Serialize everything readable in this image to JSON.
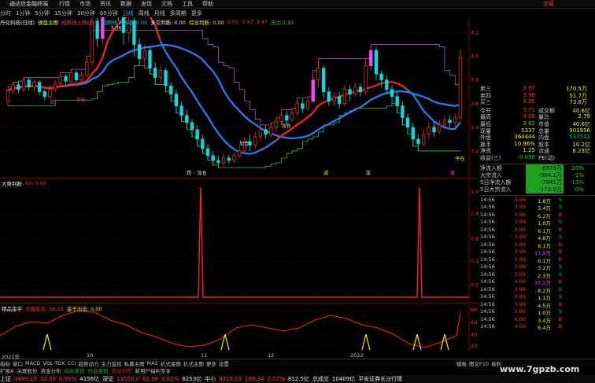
{
  "titlebar": {
    "app": "通达信金融终端",
    "menu": [
      "行情",
      "市场",
      "资讯",
      "数据",
      "发现",
      "文档",
      "工具",
      "帮助"
    ],
    "right": "交易"
  },
  "timeframes": [
    "分时",
    "1分钟",
    "5分钟",
    "15分钟",
    "30分钟",
    "60分钟",
    "日线",
    "周线",
    "月线",
    "多周期",
    "更多"
  ],
  "active_tf": "日线",
  "legend_main": [
    {
      "t": "丹化科技(日线)",
      "c": "#e8e8e8"
    },
    {
      "t": "操盘主图",
      "c": "#f0f000"
    },
    {
      "t": "趋势线上移动: 0",
      "c": "#ff3030"
    },
    {
      "t": "趋势线下移动: 0.00",
      "c": "#00d0d0"
    },
    {
      "t": "多空判断: 0.00",
      "c": "#e8e8e8"
    },
    {
      "t": "综合判断: 0.00",
      "c": "#f0f000"
    },
    {
      "t": "2.00",
      "c": "#ff3030"
    },
    {
      "t": "3.47",
      "c": "#ff3030"
    },
    {
      "t": "3.47",
      "c": "#ff3030"
    },
    {
      "t": "压力:1.91",
      "c": "#20d020"
    }
  ],
  "main_y": [
    "4.20",
    "4.00",
    "3.80",
    "3.60",
    "3.40",
    "3.20"
  ],
  "price_top": "5.36",
  "main_labels": [
    "跌",
    "跌",
    "加仓",
    "加仓",
    "加仓",
    "加仓",
    "减",
    "涨",
    "涨",
    "平仓"
  ],
  "panel2": {
    "title": "大势判断",
    "val": "60: 0.00",
    "y": [
      "1.00",
      "0.80",
      "0.60",
      "0.40",
      "0.20"
    ]
  },
  "panel3": {
    "title": "精品金字",
    "l1": "大盘变化: 56.53",
    "l2": "金子出击: 0.00",
    "y": [
      "80.00",
      "60.00",
      "40.00",
      "20.00"
    ]
  },
  "xaxis": [
    "2021年",
    "10",
    "11",
    "12",
    "2022"
  ],
  "quote": {
    "rows": [
      {
        "k": "卖三",
        "v": "3.97",
        "v2": "170.5万"
      },
      {
        "k": "卖四",
        "v": "3.96",
        "v2": "51.7万"
      },
      {
        "k": "买三",
        "v": "3.95",
        "v2": "73.8万"
      }
    ],
    "stats": [
      {
        "k": "今开",
        "v": "3.71",
        "k2": "成交额",
        "v2": "40.6亿"
      },
      {
        "k": "最高",
        "v": "4.06",
        "k2": "量比",
        "v2": "2.79"
      },
      {
        "k": "最低",
        "v": "3.62",
        "k2": "市值",
        "v2": "40.6亿"
      },
      {
        "k": "现量",
        "v": "5337",
        "k2": "总量",
        "v2": "901956"
      },
      {
        "k": "外盘",
        "v": "364444",
        "k2": "内盘",
        "v2": "537512"
      },
      {
        "k": "换手",
        "v": "10.96%",
        "k2": "股本",
        "v2": "10.2亿"
      },
      {
        "k": "净资",
        "v": "1.25",
        "k2": "流通",
        "v2": "8.23亿"
      },
      {
        "k": "收益(三)",
        "v": "-0.050",
        "k2": "PE(动)",
        "v2": ""
      }
    ],
    "flows": [
      {
        "k": "净流入额",
        "v": "-6976万",
        "p": "-20%"
      },
      {
        "k": "大宗流入",
        "v": "-504.1万",
        "p": "-1%"
      },
      {
        "k": "5日净流入额",
        "v": "-7941万",
        "p": "-13%"
      },
      {
        "k": "5日大宗流入",
        "v": "-172.0万",
        "p": "-0%"
      }
    ],
    "ticks": [
      {
        "t": "14:56",
        "p": "3.99",
        "v": "1.8万",
        "s": "S"
      },
      {
        "t": "14:56",
        "p": "3.99",
        "v": "3.4万",
        "s": "S"
      },
      {
        "t": "14:56",
        "p": "3.99",
        "v": "6.2万",
        "s": "B"
      },
      {
        "t": "14:56",
        "p": "3.99",
        "v": "1.0万",
        "s": "S"
      },
      {
        "t": "14:56",
        "p": "3.99",
        "v": "6.1万",
        "s": "B"
      },
      {
        "t": "14:56",
        "p": "3.99",
        "v": "4.8万",
        "s": "S"
      },
      {
        "t": "14:56",
        "p": "3.99",
        "v": "8.1万",
        "s": "B"
      },
      {
        "t": "14:56",
        "p": "3.99",
        "v": "17.5万",
        "s": "B"
      },
      {
        "t": "14:56",
        "p": "3.99",
        "v": "6.1万",
        "s": "B"
      },
      {
        "t": "14:56",
        "p": "3.99",
        "v": "3.2万",
        "s": "S"
      },
      {
        "t": "14:56",
        "p": "3.99",
        "v": "2.3万",
        "s": "S"
      },
      {
        "t": "14:56",
        "p": "4.00",
        "v": "37.2万",
        "s": "B"
      },
      {
        "t": "14:56",
        "p": "3.99",
        "v": "8.2万",
        "s": "S"
      },
      {
        "t": "14:56",
        "p": "3.99",
        "v": "1.1万",
        "s": "S"
      },
      {
        "t": "14:56",
        "p": "3.99",
        "v": "4.5万",
        "s": "B"
      },
      {
        "t": "14:56",
        "p": "3.99",
        "v": "1.0万",
        "s": "S"
      },
      {
        "t": "14:56",
        "p": "4.00",
        "v": "3.4万",
        "s": "B"
      },
      {
        "t": "14:56",
        "p": "4.00",
        "v": "6.4万",
        "s": "B"
      }
    ]
  },
  "tabs": [
    "指标",
    "窗口",
    "MACD",
    "VOL-TDX",
    "CCI",
    "趋势动力",
    "主力监控",
    "私募主图",
    "MA2",
    "扒式金图",
    "扒式主图",
    "更多",
    "设置"
  ],
  "tabs2": [
    {
      "t": "扩展A",
      "c": "w"
    },
    {
      "t": "关联股份",
      "c": "w"
    },
    {
      "t": "资金分布",
      "c": "w"
    },
    {
      "t": "综合资讯",
      "c": "green"
    },
    {
      "t": "行业资讯",
      "c": "green"
    },
    {
      "t": "互动问答",
      "c": "red"
    },
    {
      "t": "新用户福利专享",
      "c": "w"
    }
  ],
  "tabs_right": [
    "模板",
    "图文F10",
    "易利"
  ],
  "status": [
    {
      "t": "上证",
      "c": "w"
    },
    {
      "t": "3489.15",
      "c": "r"
    },
    {
      "t": "32.00",
      "c": "r"
    },
    {
      "t": "0.93%",
      "c": "r"
    },
    {
      "t": "4156亿",
      "c": "w"
    },
    {
      "t": "深证",
      "c": "w"
    },
    {
      "t": "13550.0",
      "c": "r"
    },
    {
      "t": "82.98",
      "c": "r"
    },
    {
      "t": "0.62%",
      "c": "r"
    },
    {
      "t": "6253亿",
      "c": "w"
    },
    {
      "t": "中小",
      "c": "w"
    },
    {
      "t": "9315.03",
      "c": "r"
    },
    {
      "t": "189.34",
      "c": "r"
    },
    {
      "t": "2.07%",
      "c": "r"
    },
    {
      "t": "812.5亿",
      "c": "w"
    },
    {
      "t": "总成交",
      "c": "w"
    },
    {
      "t": "10409亿",
      "c": "w"
    },
    {
      "t": "平安证券长沙行情",
      "c": "w"
    }
  ],
  "watermark": "www.7gpzb.com",
  "candles": [
    [
      3.62,
      3.71,
      3.58,
      3.74
    ],
    [
      3.71,
      3.76,
      3.68,
      3.78
    ],
    [
      3.76,
      3.72,
      3.69,
      3.79
    ],
    [
      3.72,
      3.8,
      3.7,
      3.82
    ],
    [
      3.8,
      3.74,
      3.71,
      3.82
    ],
    [
      3.74,
      3.78,
      3.7,
      3.8
    ],
    [
      3.78,
      3.7,
      3.67,
      3.8
    ],
    [
      3.7,
      3.66,
      3.63,
      3.72
    ],
    [
      3.66,
      3.72,
      3.64,
      3.75
    ],
    [
      3.72,
      3.77,
      3.7,
      3.8
    ],
    [
      3.77,
      3.83,
      3.75,
      3.86
    ],
    [
      3.83,
      3.79,
      3.76,
      3.85
    ],
    [
      3.79,
      3.86,
      3.77,
      3.89
    ],
    [
      3.86,
      3.8,
      3.78,
      3.88
    ],
    [
      3.8,
      3.84,
      3.78,
      3.87
    ],
    [
      3.84,
      3.95,
      3.82,
      4.0
    ],
    [
      3.95,
      4.3,
      3.92,
      4.4
    ],
    [
      4.3,
      4.15,
      4.08,
      4.42
    ],
    [
      4.15,
      4.6,
      4.1,
      4.75
    ],
    [
      4.6,
      5.2,
      4.55,
      5.36
    ],
    [
      5.2,
      4.65,
      4.5,
      5.25
    ],
    [
      4.65,
      4.4,
      4.3,
      4.7
    ],
    [
      4.4,
      4.2,
      4.1,
      4.45
    ],
    [
      4.2,
      4.3,
      4.12,
      4.38
    ],
    [
      4.3,
      4.1,
      4.0,
      4.33
    ],
    [
      4.1,
      3.98,
      3.92,
      4.15
    ],
    [
      3.98,
      4.05,
      3.9,
      4.1
    ],
    [
      4.05,
      3.9,
      3.85,
      4.08
    ],
    [
      3.9,
      3.82,
      3.76,
      3.95
    ],
    [
      3.82,
      3.88,
      3.78,
      3.92
    ],
    [
      3.88,
      3.75,
      3.7,
      3.9
    ],
    [
      3.75,
      3.68,
      3.62,
      3.78
    ],
    [
      3.68,
      3.58,
      3.52,
      3.72
    ],
    [
      3.58,
      3.5,
      3.45,
      3.62
    ],
    [
      3.5,
      3.44,
      3.38,
      3.55
    ],
    [
      3.44,
      3.38,
      3.32,
      3.47
    ],
    [
      3.38,
      3.3,
      3.24,
      3.42
    ],
    [
      3.3,
      3.22,
      3.18,
      3.34
    ],
    [
      3.22,
      3.16,
      3.12,
      3.26
    ],
    [
      3.16,
      3.12,
      3.08,
      3.2
    ],
    [
      3.12,
      3.1,
      3.06,
      3.16
    ],
    [
      3.1,
      3.14,
      3.07,
      3.18
    ],
    [
      3.14,
      3.12,
      3.09,
      3.17
    ],
    [
      3.12,
      3.16,
      3.1,
      3.19
    ],
    [
      3.16,
      3.2,
      3.14,
      3.24
    ],
    [
      3.2,
      3.28,
      3.18,
      3.32
    ],
    [
      3.28,
      3.25,
      3.2,
      3.34
    ],
    [
      3.25,
      3.32,
      3.22,
      3.36
    ],
    [
      3.32,
      3.38,
      3.28,
      3.42
    ],
    [
      3.38,
      3.34,
      3.3,
      3.42
    ],
    [
      3.34,
      3.4,
      3.32,
      3.44
    ],
    [
      3.4,
      3.45,
      3.36,
      3.48
    ],
    [
      3.45,
      3.5,
      3.42,
      3.55
    ],
    [
      3.5,
      3.46,
      3.42,
      3.54
    ],
    [
      3.46,
      3.52,
      3.44,
      3.56
    ],
    [
      3.52,
      3.6,
      3.5,
      3.65
    ],
    [
      3.6,
      3.56,
      3.52,
      3.64
    ],
    [
      3.56,
      3.62,
      3.54,
      3.66
    ],
    [
      3.62,
      3.8,
      3.6,
      3.88
    ],
    [
      3.8,
      3.9,
      3.74,
      3.98
    ],
    [
      3.9,
      3.7,
      3.64,
      3.92
    ],
    [
      3.7,
      3.62,
      3.58,
      3.74
    ],
    [
      3.62,
      3.66,
      3.58,
      3.7
    ],
    [
      3.66,
      3.6,
      3.56,
      3.7
    ],
    [
      3.6,
      3.72,
      3.58,
      3.76
    ],
    [
      3.72,
      3.68,
      3.62,
      3.76
    ],
    [
      3.68,
      3.74,
      3.66,
      3.78
    ],
    [
      3.74,
      3.7,
      3.66,
      3.77
    ],
    [
      3.7,
      3.92,
      3.68,
      3.98
    ],
    [
      3.92,
      4.05,
      3.88,
      4.1
    ],
    [
      4.05,
      3.85,
      3.8,
      4.08
    ],
    [
      3.85,
      3.8,
      3.74,
      3.88
    ],
    [
      3.8,
      3.72,
      3.68,
      3.84
    ],
    [
      3.72,
      3.66,
      3.6,
      3.76
    ],
    [
      3.66,
      3.58,
      3.52,
      3.7
    ],
    [
      3.58,
      3.48,
      3.42,
      3.62
    ],
    [
      3.48,
      3.4,
      3.34,
      3.52
    ],
    [
      3.4,
      3.3,
      3.24,
      3.44
    ],
    [
      3.3,
      3.26,
      3.2,
      3.34
    ],
    [
      3.26,
      3.34,
      3.24,
      3.38
    ],
    [
      3.34,
      3.4,
      3.3,
      3.44
    ],
    [
      3.4,
      3.36,
      3.32,
      3.44
    ],
    [
      3.36,
      3.42,
      3.34,
      3.46
    ],
    [
      3.42,
      3.46,
      3.38,
      3.5
    ],
    [
      3.46,
      3.44,
      3.4,
      3.5
    ],
    [
      3.44,
      3.48,
      3.4,
      3.52
    ],
    [
      3.48,
      3.99,
      3.46,
      4.06
    ]
  ]
}
